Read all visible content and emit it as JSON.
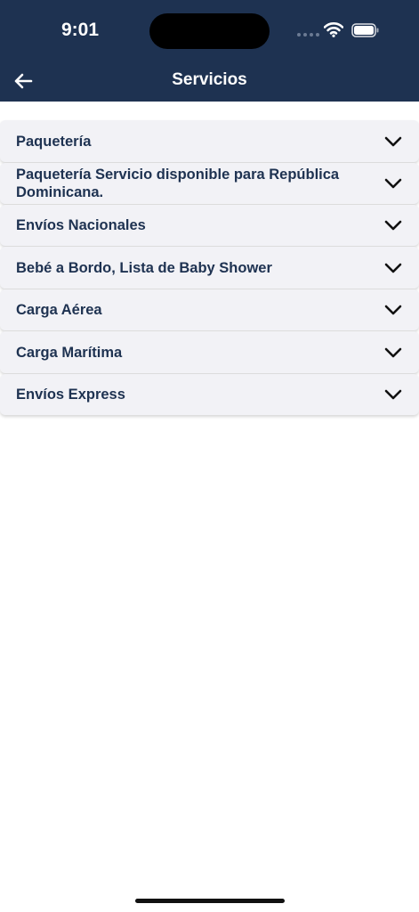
{
  "status_bar": {
    "time": "9:01"
  },
  "header": {
    "title": "Servicios",
    "back_icon": "arrow-left-icon",
    "background": "#1e3251"
  },
  "services": [
    {
      "label": "Paquetería"
    },
    {
      "label": "Paquetería Servicio disponible para República Dominicana."
    },
    {
      "label": "Envíos Nacionales"
    },
    {
      "label": "Bebé a Bordo, Lista de Baby Shower"
    },
    {
      "label": "Carga Aérea"
    },
    {
      "label": "Carga Marítima"
    },
    {
      "label": "Envíos Express"
    }
  ],
  "colors": {
    "accent": "#1e3251",
    "row_background": "#f2f2f6"
  }
}
